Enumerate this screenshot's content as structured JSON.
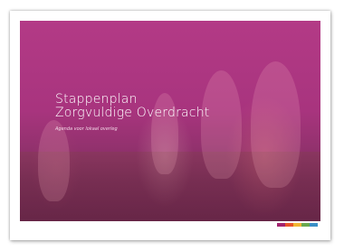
{
  "document": {
    "title_line1": "Stappenplan",
    "title_line2": "Zorgvuldige Overdracht",
    "subtitle": "Agenda voor lokaal overleg"
  },
  "colors": {
    "overlay": "#a8347e",
    "stripe": [
      "#a3236f",
      "#e8552b",
      "#f2b632",
      "#6aa84f",
      "#3a8fc7"
    ]
  }
}
